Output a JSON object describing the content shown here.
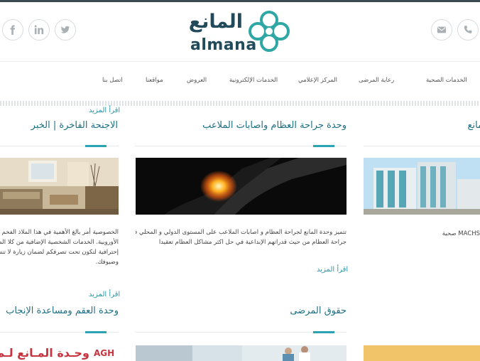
{
  "brand": {
    "name_ar": "المانع",
    "name_en": "almana"
  },
  "social": {
    "facebook": "facebook-icon",
    "linkedin": "linkedin-icon",
    "twitter": "twitter-icon"
  },
  "contact": {
    "mail": "mail-icon",
    "phone": "phone-icon"
  },
  "nav": {
    "items": [
      "الخدمات الصحية",
      "رعاية المرضى",
      "المركز الإعلامي",
      "الخدمات الإلكترونية",
      "العروض",
      "مواقعنا",
      "اتصل بنا"
    ]
  },
  "colors": {
    "accent": "#2aa3b4",
    "title": "#1d6f82",
    "brand": "#214a5a"
  },
  "cards": {
    "suites": {
      "read_more": "اقرأ المزيد",
      "title": "الاجنحة الفاخرة | الخبر",
      "lines": [
        "الخصوصية أمر بالغ الأهمية في هذا الملاذ الفخم و",
        "الأوروبية. الخدمات الشخصية الإضافية من كلا الم",
        "إحترافية لتكون تحت تصرفكم لضمان زيارة لا تنسى",
        "وضيوفك."
      ]
    },
    "ortho": {
      "title": "وحدة جراحة العظام واصابات الملاعب",
      "lines": [
        "تتميز وحدة المانع لجراحة العظام و اصابات الملاعب على المستوى الدولي و المحلي في",
        "جراحة العظام من حيث قدراتهم الإبداعية في حل اكثر مشاكل العظام تعقيدا"
      ],
      "read_more": "اقرأ المزيد"
    },
    "right_partial": {
      "title": "مانع",
      "text": "MACHS صحية"
    },
    "ivf": {
      "read_more": "اقرأ المزيد",
      "title": "وحدة العقم ومساعدة الإنجاب",
      "banner_ar": "وحـدة المـانع لـم",
      "banner_logo": "AGH"
    },
    "rights": {
      "title": "حقوق المرضى"
    }
  }
}
